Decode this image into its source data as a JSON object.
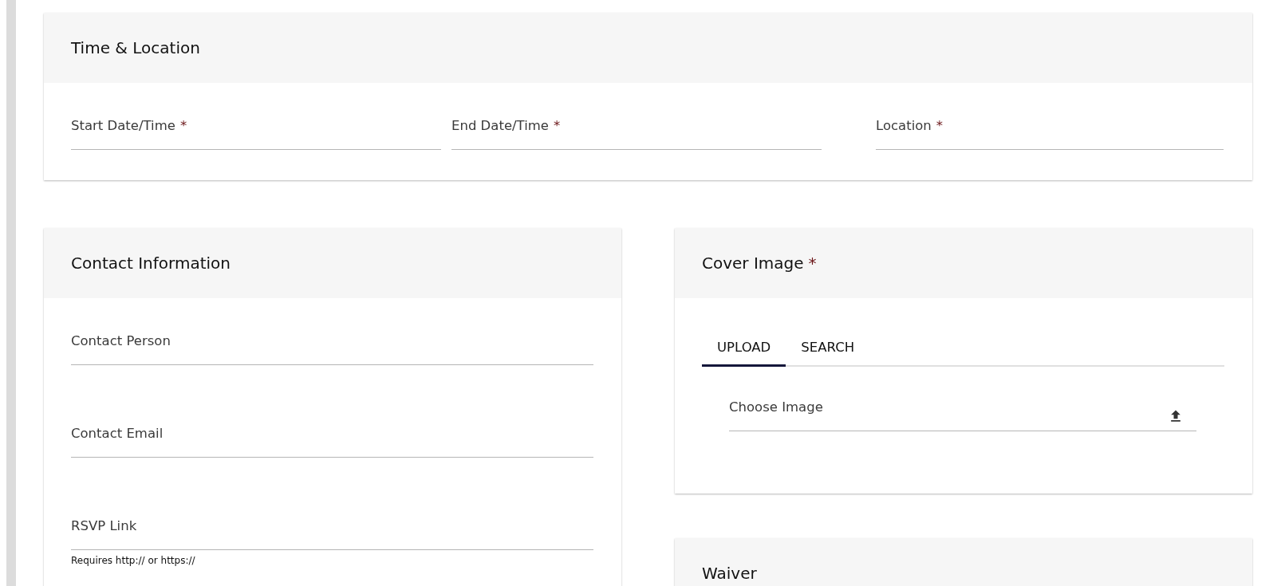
{
  "time_location": {
    "title": "Time & Location",
    "fields": [
      {
        "label": "Start Date/Time",
        "required_mark": "*"
      },
      {
        "label": "End Date/Time",
        "required_mark": "*"
      },
      {
        "label": "Location",
        "required_mark": "*"
      }
    ]
  },
  "contact": {
    "title": "Contact Information",
    "fields": [
      {
        "label": "Contact Person"
      },
      {
        "label": "Contact Email"
      },
      {
        "label": "RSVP Link",
        "helper": "Requires http:// or https://"
      }
    ]
  },
  "cover_image": {
    "title": "Cover Image",
    "required_mark": "*",
    "tabs": [
      {
        "label": "UPLOAD",
        "selected": true
      },
      {
        "label": "SEARCH",
        "selected": false
      }
    ],
    "file_field": {
      "label": "Choose Image"
    }
  },
  "waiver": {
    "title": "Waiver"
  }
}
